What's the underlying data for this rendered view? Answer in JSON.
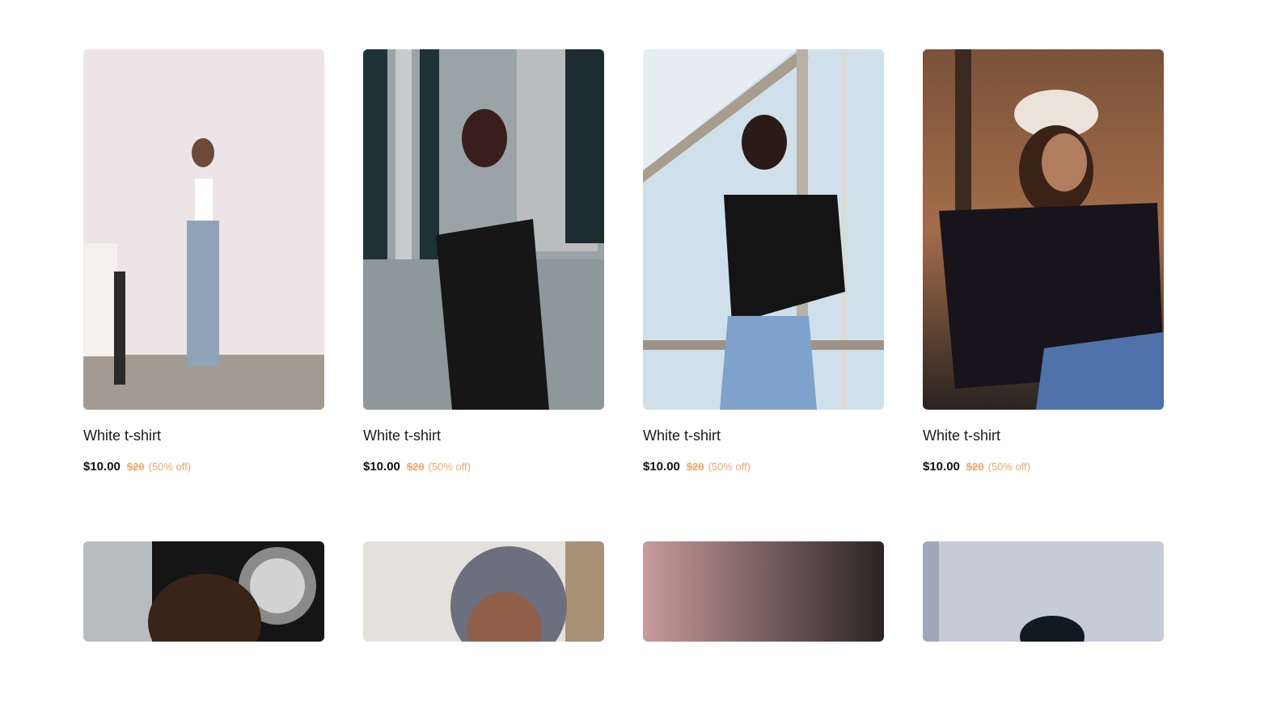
{
  "products": [
    {
      "title": "White t-shirt",
      "price": "$10.00",
      "old_price": "$20",
      "discount": "(50% off)"
    },
    {
      "title": "White t-shirt",
      "price": "$10.00",
      "old_price": "$20",
      "discount": "(50% off)"
    },
    {
      "title": "White t-shirt",
      "price": "$10.00",
      "old_price": "$20",
      "discount": "(50% off)"
    },
    {
      "title": "White t-shirt",
      "price": "$10.00",
      "old_price": "$20",
      "discount": "(50% off)"
    }
  ],
  "colors": {
    "price": "#111111",
    "old_price": "#f0a86a",
    "discount": "#f0a86a",
    "background": "#ffffff"
  }
}
